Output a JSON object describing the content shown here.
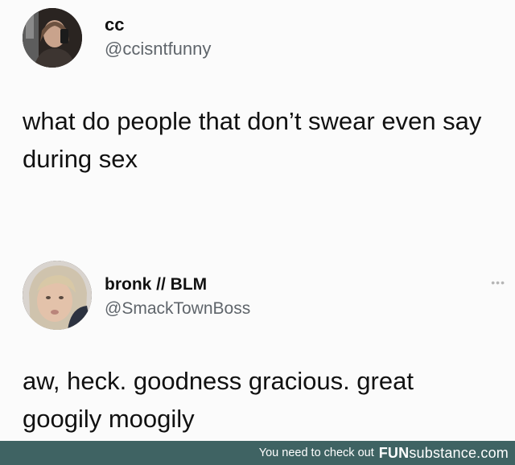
{
  "tweets": [
    {
      "display_name": "cc",
      "handle": "@ccisntfunny",
      "text": "what do people that don’t swear even say during sex"
    },
    {
      "display_name": "bronk // BLM",
      "handle": "@SmackTownBoss",
      "more": "•••",
      "text": "aw, heck. goodness gracious. great googily moogily"
    }
  ],
  "footer": {
    "text": "You need to check out",
    "brand_fun": "FUN",
    "brand_rest": "substance.com"
  }
}
